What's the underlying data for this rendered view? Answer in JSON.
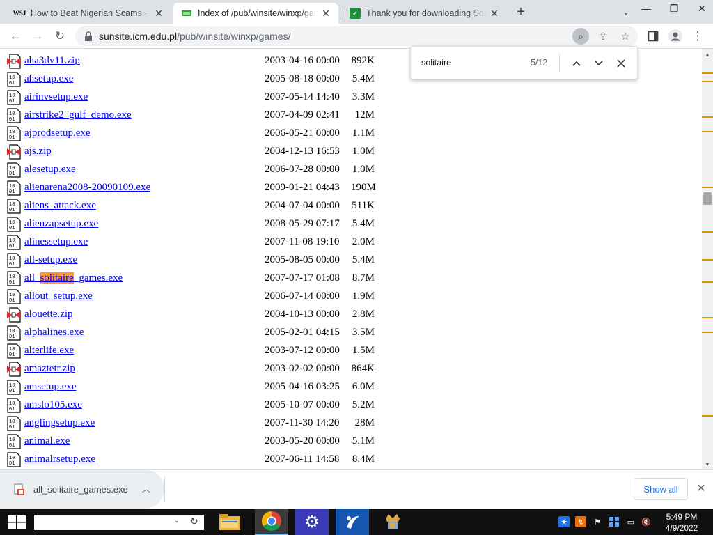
{
  "browser": {
    "tabs": [
      {
        "title": "How to Beat Nigerian Scams - W",
        "favicon": "WSJ"
      },
      {
        "title": "Index of /pub/winsite/winxp/gan",
        "favicon": ""
      },
      {
        "title": "Thank you for downloading Solit",
        "favicon": ""
      }
    ],
    "url_domain": "sunsite.icm.edu.pl",
    "url_path": "/pub/winsite/winxp/games/"
  },
  "find_bar": {
    "query": "solitaire",
    "count": "5/12"
  },
  "files": [
    {
      "name": "aha3dv11.zip",
      "date": "2003-04-16 00:00",
      "size": "892K",
      "icon": "compressed-file-icon"
    },
    {
      "name": "ahsetup.exe",
      "date": "2005-08-18 00:00",
      "size": "5.4M",
      "icon": "binary-file-icon"
    },
    {
      "name": "airinvsetup.exe",
      "date": "2007-05-14 14:40",
      "size": "3.3M",
      "icon": "binary-file-icon"
    },
    {
      "name": "airstrike2_gulf_demo.exe",
      "date": "2007-04-09 02:41",
      "size": "12M",
      "icon": "binary-file-icon"
    },
    {
      "name": "ajprodsetup.exe",
      "date": "2006-05-21 00:00",
      "size": "1.1M",
      "icon": "binary-file-icon"
    },
    {
      "name": "ajs.zip",
      "date": "2004-12-13 16:53",
      "size": "1.0M",
      "icon": "compressed-file-icon"
    },
    {
      "name": "alesetup.exe",
      "date": "2006-07-28 00:00",
      "size": "1.0M",
      "icon": "binary-file-icon"
    },
    {
      "name": "alienarena2008-20090109.exe",
      "date": "2009-01-21 04:43",
      "size": "190M",
      "icon": "binary-file-icon"
    },
    {
      "name": "aliens_attack.exe",
      "date": "2004-07-04 00:00",
      "size": "511K",
      "icon": "binary-file-icon"
    },
    {
      "name": "alienzapsetup.exe",
      "date": "2008-05-29 07:17",
      "size": "5.4M",
      "icon": "binary-file-icon"
    },
    {
      "name": "alinessetup.exe",
      "date": "2007-11-08 19:10",
      "size": "2.0M",
      "icon": "binary-file-icon"
    },
    {
      "name": "all-setup.exe",
      "date": "2005-08-05 00:00",
      "size": "5.4M",
      "icon": "binary-file-icon"
    },
    {
      "name": "all_solitaire_games.exe",
      "date": "2007-07-17 01:08",
      "size": "8.7M",
      "icon": "binary-file-icon",
      "name_pre": "all_",
      "name_match": "solitaire",
      "name_post": "_games.exe"
    },
    {
      "name": "allout_setup.exe",
      "date": "2006-07-14 00:00",
      "size": "1.9M",
      "icon": "binary-file-icon"
    },
    {
      "name": "alouette.zip",
      "date": "2004-10-13 00:00",
      "size": "2.8M",
      "icon": "compressed-file-icon"
    },
    {
      "name": "alphalines.exe",
      "date": "2005-02-01 04:15",
      "size": "3.5M",
      "icon": "binary-file-icon"
    },
    {
      "name": "alterlife.exe",
      "date": "2003-07-12 00:00",
      "size": "1.5M",
      "icon": "binary-file-icon"
    },
    {
      "name": "amaztetr.zip",
      "date": "2003-02-02 00:00",
      "size": "864K",
      "icon": "compressed-file-icon"
    },
    {
      "name": "amsetup.exe",
      "date": "2005-04-16 03:25",
      "size": "6.0M",
      "icon": "binary-file-icon"
    },
    {
      "name": "amslo105.exe",
      "date": "2005-10-07 00:00",
      "size": "5.2M",
      "icon": "binary-file-icon"
    },
    {
      "name": "anglingsetup.exe",
      "date": "2007-11-30 14:20",
      "size": "28M",
      "icon": "binary-file-icon"
    },
    {
      "name": "animal.exe",
      "date": "2003-05-20 00:00",
      "size": "5.1M",
      "icon": "binary-file-icon"
    },
    {
      "name": "animalrsetup.exe",
      "date": "2007-06-11 14:58",
      "size": "8.4M",
      "icon": "binary-file-icon"
    }
  ],
  "download_bar": {
    "filename": "all_solitaire_games.exe",
    "show_all": "Show all"
  },
  "taskbar": {
    "time": "5:49 PM",
    "date": "4/9/2022"
  },
  "colors": {
    "link": "#0000ee",
    "find_highlight": "#ff9632",
    "scroll_marker": "#d79600",
    "accent": "#1a73e8"
  }
}
